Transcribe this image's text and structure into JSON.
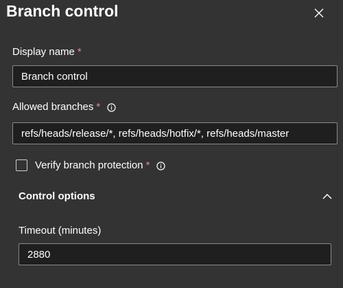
{
  "panel": {
    "title": "Branch control",
    "close_icon": "close-icon"
  },
  "display_name": {
    "label": "Display name",
    "required_mark": "*",
    "value": "Branch control"
  },
  "allowed_branches": {
    "label": "Allowed branches",
    "required_mark": "*",
    "info_icon": "info-icon",
    "value": "refs/heads/release/*, refs/heads/hotfix/*, refs/heads/master"
  },
  "verify_protection": {
    "label": "Verify branch protection",
    "required_mark": "*",
    "info_icon": "info-icon",
    "checked": false
  },
  "control_options": {
    "title": "Control options",
    "collapse_icon": "chevron-up-icon",
    "timeout": {
      "label": "Timeout (minutes)",
      "value": "2880"
    }
  },
  "colors": {
    "background": "#333333",
    "input_background": "#1f1f1f",
    "input_border": "#8a8a8a",
    "required": "#e08a8a",
    "text": "#ffffff"
  }
}
